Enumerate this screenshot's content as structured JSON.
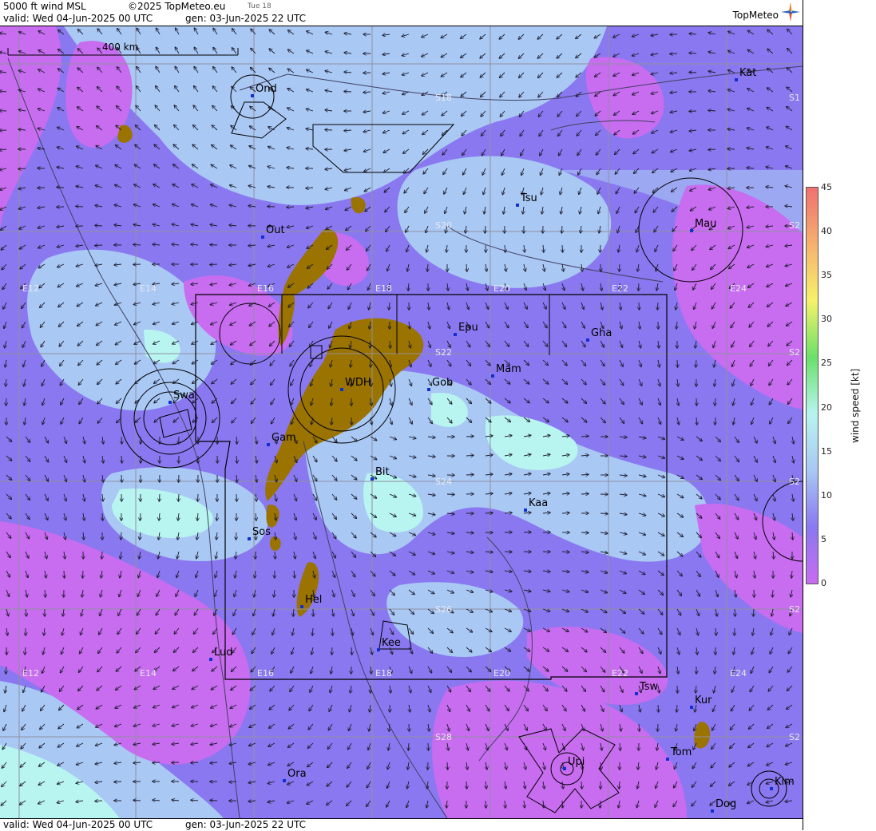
{
  "header": {
    "product": "5000 ft wind MSL",
    "copyright": "©2025 TopMeteo.eu",
    "day_tag": "Tue 18",
    "valid": "valid:  Wed  04-Jun-2025  00 UTC",
    "generated": "gen: 03-Jun-2025 22 UTC",
    "brand": "TopMeteo"
  },
  "footer": {
    "valid": "valid:  Wed  04-Jun-2025  00 UTC",
    "generated": "gen: 03-Jun-2025 22 UTC"
  },
  "scale_bar": {
    "label": "400 km"
  },
  "legend": {
    "title": "wind speed [kt]",
    "ticks": [
      "45",
      "40",
      "35",
      "30",
      "25",
      "20",
      "15",
      "10",
      "5",
      "0"
    ],
    "colors": [
      "#c86cf0",
      "#8a78f0",
      "#a9c8f4",
      "#b8f4f0",
      "#6ae06a",
      "#f6f26a",
      "#f6b070",
      "#f07070"
    ]
  },
  "places": [
    {
      "name": "Ond"
    },
    {
      "name": "Out"
    },
    {
      "name": "Tsu"
    },
    {
      "name": "Mau"
    },
    {
      "name": "Kat"
    },
    {
      "name": "Epu"
    },
    {
      "name": "Gha"
    },
    {
      "name": "Swa"
    },
    {
      "name": "WDH"
    },
    {
      "name": "Gob"
    },
    {
      "name": "Mam"
    },
    {
      "name": "Gam"
    },
    {
      "name": "Bit"
    },
    {
      "name": "Kaa"
    },
    {
      "name": "Sos"
    },
    {
      "name": "Hel"
    },
    {
      "name": "Lud"
    },
    {
      "name": "Kee"
    },
    {
      "name": "Tsw"
    },
    {
      "name": "Kur"
    },
    {
      "name": "Tom"
    },
    {
      "name": "Ora"
    },
    {
      "name": "Upi"
    },
    {
      "name": "Kim"
    },
    {
      "name": "Dog"
    }
  ],
  "graticule": {
    "lon_labels_upper": [
      "E12",
      "E14",
      "E16",
      "E18",
      "E20",
      "E22",
      "E24"
    ],
    "lon_labels_lower": [
      "E12",
      "E14",
      "E16",
      "E18",
      "E20",
      "E22",
      "E24"
    ],
    "lat_labels": [
      "S18",
      "S20",
      "S22",
      "S24",
      "S26",
      "S28"
    ],
    "lat_labels_right": [
      "S1",
      "S2",
      "S2",
      "S2",
      "S2",
      "S2"
    ]
  }
}
